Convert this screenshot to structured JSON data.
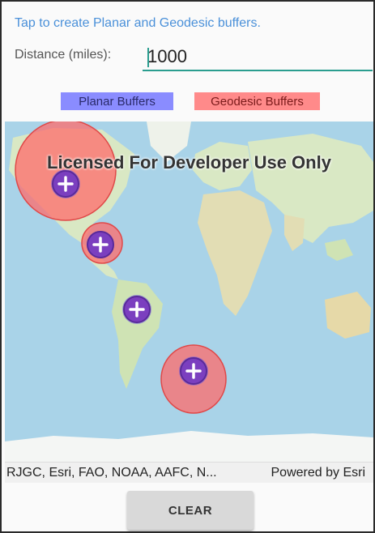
{
  "instructions": "Tap to create Planar and Geodesic buffers.",
  "distance": {
    "label": "Distance (miles):",
    "value": "1000"
  },
  "legend": {
    "planar": "Planar Buffers",
    "geodesic": "Geodesic Buffers"
  },
  "map": {
    "watermark": "Licensed For Developer Use Only",
    "attribution": "RJGC, Esri, FAO, NOAA, AAFC, N...",
    "powered_by": "Powered by Esri",
    "colors": {
      "ocean": "#a9d3e8",
      "land": "#d9e8c4",
      "planar_buffer": "#6e5ce0",
      "geodesic_buffer": "#ff6b6b",
      "marker": "#7b3fbf"
    }
  },
  "clear_button": "CLEAR"
}
